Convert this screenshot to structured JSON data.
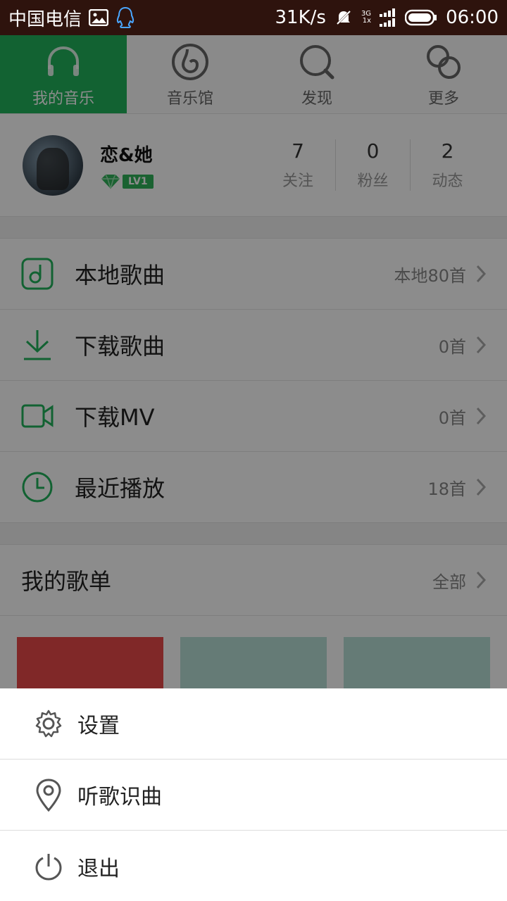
{
  "statusbar": {
    "carrier": "中国电信",
    "speed": "31K/s",
    "net_top": "3G",
    "net_bottom": "1x",
    "time": "06:00"
  },
  "tabs": [
    {
      "label": "我的音乐",
      "icon": "headphones-icon",
      "active": true
    },
    {
      "label": "音乐馆",
      "icon": "music-disc-icon",
      "active": false
    },
    {
      "label": "发现",
      "icon": "search-icon",
      "active": false
    },
    {
      "label": "更多",
      "icon": "more-circles-icon",
      "active": false
    }
  ],
  "profile": {
    "name": "恋&她",
    "level": "LV1",
    "stats": [
      {
        "num": "7",
        "label": "关注"
      },
      {
        "num": "0",
        "label": "粉丝"
      },
      {
        "num": "2",
        "label": "动态"
      }
    ]
  },
  "menu": [
    {
      "label": "本地歌曲",
      "value": "本地80首",
      "icon": "local-music-icon"
    },
    {
      "label": "下载歌曲",
      "value": "0首",
      "icon": "download-icon"
    },
    {
      "label": "下载MV",
      "value": "0首",
      "icon": "video-camera-icon"
    },
    {
      "label": "最近播放",
      "value": "18首",
      "icon": "clock-icon"
    }
  ],
  "playlist": {
    "title": "我的歌单",
    "all": "全部"
  },
  "sheet": [
    {
      "label": "设置",
      "icon": "gear-icon"
    },
    {
      "label": "听歌识曲",
      "icon": "location-pin-icon"
    },
    {
      "label": "退出",
      "icon": "power-icon"
    }
  ],
  "colors": {
    "accent": "#22b35c",
    "statusbar": "#2e130d",
    "cover1": "#e94a4a",
    "cover2": "#b8e0d8",
    "cover3": "#b8e0d8"
  }
}
